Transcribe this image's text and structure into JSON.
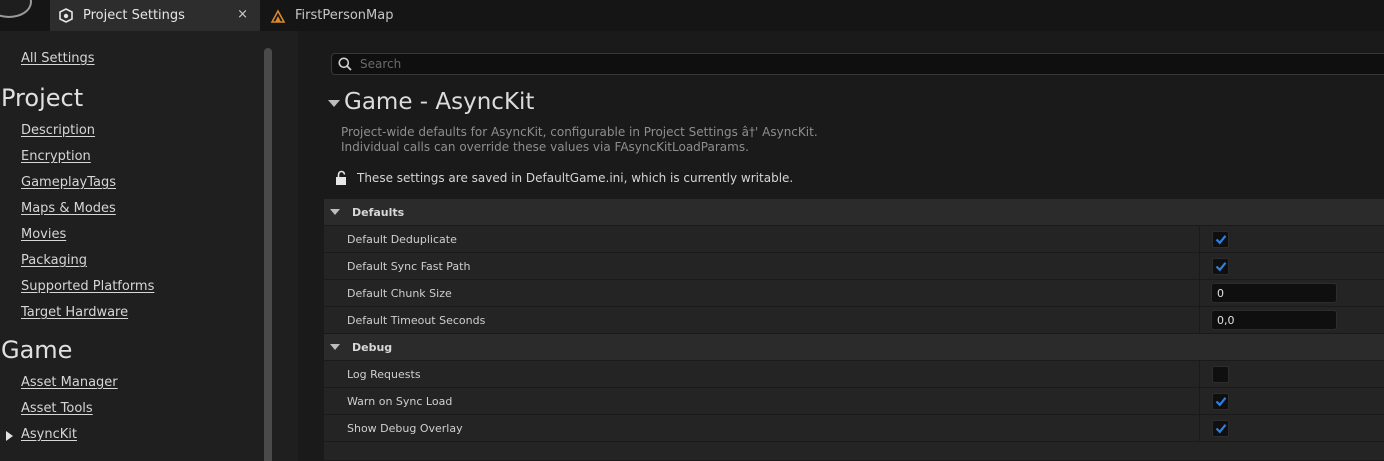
{
  "tabs": [
    {
      "label": "Project Settings",
      "icon": "settings-icon",
      "active": true,
      "close": "×"
    },
    {
      "label": "FirstPersonMap",
      "icon": "level-map-icon",
      "active": false
    }
  ],
  "sidebar": {
    "all_settings": "All Settings",
    "project_heading": "Project",
    "project_items": [
      {
        "label": "Description"
      },
      {
        "label": "Encryption"
      },
      {
        "label": "GameplayTags"
      },
      {
        "label": "Maps & Modes"
      },
      {
        "label": "Movies"
      },
      {
        "label": "Packaging"
      },
      {
        "label": "Supported Platforms"
      },
      {
        "label": "Target Hardware"
      }
    ],
    "game_heading": "Game",
    "game_items": [
      {
        "label": "Asset Manager"
      },
      {
        "label": "Asset Tools"
      },
      {
        "label": "AsyncKit",
        "selected": true
      }
    ]
  },
  "search": {
    "placeholder": "Search"
  },
  "section": {
    "title": "Game - AsyncKit",
    "description_line1": "Project-wide defaults for AsyncKit, configurable in Project Settings â†' AsyncKit.",
    "description_line2": "Individual calls can override these values via FAsyncKitLoadParams.",
    "saved_notice": "These settings are saved in DefaultGame.ini, which is currently writable."
  },
  "categories": {
    "defaults": {
      "label": "Defaults",
      "props": {
        "deduplicate": {
          "label": "Default Deduplicate",
          "checked": true
        },
        "sync_fast_path": {
          "label": "Default Sync Fast Path",
          "checked": true
        },
        "chunk_size": {
          "label": "Default Chunk Size",
          "value": "0"
        },
        "timeout": {
          "label": "Default Timeout Seconds",
          "value": "0,0"
        }
      }
    },
    "debug": {
      "label": "Debug",
      "props": {
        "log_requests": {
          "label": "Log Requests",
          "checked": false
        },
        "warn_sync_load": {
          "label": "Warn on Sync Load",
          "checked": true
        },
        "show_overlay": {
          "label": "Show Debug Overlay",
          "checked": true
        }
      }
    }
  },
  "colors": {
    "accent_check": "#2f7fe0",
    "background": "#1a1a1a"
  }
}
